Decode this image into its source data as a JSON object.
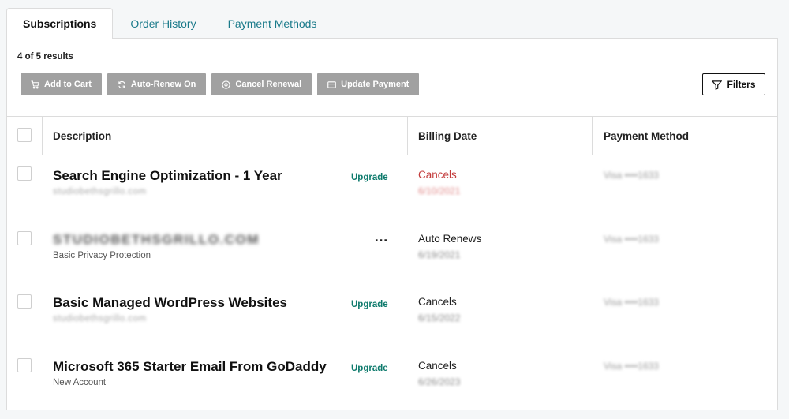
{
  "tabs": [
    {
      "label": "Subscriptions",
      "active": true
    },
    {
      "label": "Order History",
      "active": false
    },
    {
      "label": "Payment Methods",
      "active": false
    }
  ],
  "results_text": "4 of 5 results",
  "actions": {
    "add_to_cart": "Add to Cart",
    "auto_renew_on": "Auto-Renew On",
    "cancel_renewal": "Cancel Renewal",
    "update_payment": "Update Payment"
  },
  "filters_label": "Filters",
  "columns": {
    "description": "Description",
    "billing_date": "Billing Date",
    "payment_method": "Payment Method"
  },
  "rows": [
    {
      "title": "Search Engine Optimization - 1 Year",
      "subtitle": "studiobethsgrillo.com",
      "subtitle_blurred": true,
      "action": "Upgrade",
      "status": "Cancels",
      "status_color": "#c33b3b",
      "date": "6/10/2021",
      "payment": "Visa ••••1633"
    },
    {
      "title": "STUDIOBETHSGRILLO.COM",
      "title_blurred": true,
      "subtitle": "Basic Privacy Protection",
      "action": "…",
      "status": "Auto Renews",
      "date": "6/19/2021",
      "payment": "Visa ••••1633"
    },
    {
      "title": "Basic Managed WordPress Websites",
      "subtitle": "studiobethsgrillo.com",
      "subtitle_blurred": true,
      "action": "Upgrade",
      "status": "Cancels",
      "date": "6/15/2022",
      "payment": "Visa ••••1633"
    },
    {
      "title": "Microsoft 365 Starter Email From GoDaddy",
      "subtitle": "New Account",
      "action": "Upgrade",
      "status": "Cancels",
      "date": "6/26/2023",
      "payment": "Visa ••••1633"
    }
  ],
  "colors": {
    "accent_link": "#1a7a8a",
    "upgrade": "#0d7a6c",
    "cancel_red": "#c33b3b",
    "disabled_button": "#a1a1a1"
  },
  "icons": {
    "add_to_cart": "cart-icon",
    "auto_renew_on": "refresh-icon",
    "cancel_renewal": "cancel-circle-icon",
    "update_payment": "credit-card-icon",
    "filters": "filter-icon"
  }
}
